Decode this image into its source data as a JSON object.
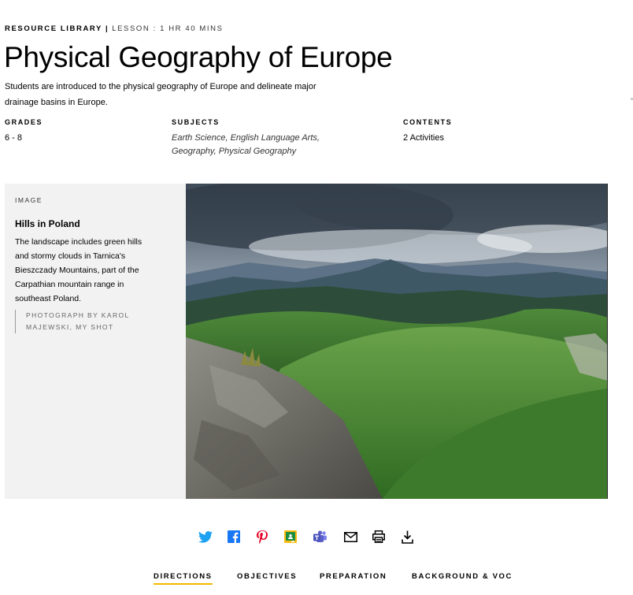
{
  "header": {
    "library": "RESOURCE LIBRARY",
    "separator": "|",
    "lesson": "LESSON : 1 HR 40 MINS",
    "title": "Physical Geography of Europe",
    "description": "Students are introduced to the physical geography of Europe and delineate major drainage basins in Europe."
  },
  "meta": {
    "grades_label": "GRADES",
    "grades_value": "6 - 8",
    "subjects_label": "SUBJECTS",
    "subjects_line1": "Earth Science, English Language Arts,",
    "subjects_line2": "Geography, Physical Geography",
    "contents_label": "CONTENTS",
    "contents_value": "2 Activities"
  },
  "image_caption": {
    "type": "IMAGE",
    "title": "Hills in Poland",
    "text": "The landscape includes green hills and stormy clouds in Tarnica's Bieszczady Mountains, part of the Carpathian mountain range in southeast Poland.",
    "credit": "PHOTOGRAPH BY KAROL MAJEWSKI, MY SHOT"
  },
  "share_icons": [
    "twitter-icon",
    "facebook-icon",
    "pinterest-icon",
    "google-classroom-icon",
    "microsoft-teams-icon",
    "email-icon",
    "print-icon",
    "download-icon"
  ],
  "colors": {
    "twitter": "#1da1f2",
    "facebook": "#1877f2",
    "pinterest": "#e60023",
    "teams": "#5b5fc7",
    "tab_underline": "#f5b800",
    "caption_bg": "#f2f2f2"
  },
  "tabs": [
    {
      "label": "DIRECTIONS",
      "active": true
    },
    {
      "label": "OBJECTIVES",
      "active": false
    },
    {
      "label": "PREPARATION",
      "active": false
    },
    {
      "label": "BACKGROUND & VOCABULARY",
      "active": false
    }
  ]
}
